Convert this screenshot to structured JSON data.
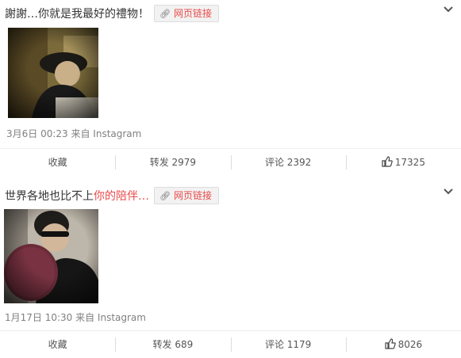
{
  "posts": [
    {
      "text_plain": "謝謝…你就是我最好的禮物！",
      "text_highlight": "",
      "weblink_label": "网页链接",
      "meta": "3月6日 00:23 来自 Instagram",
      "actions": {
        "fav": "收藏",
        "repost": "转发 2979",
        "comment": "评论 2392",
        "like": "17325"
      }
    },
    {
      "text_plain": "世界各地也比不上",
      "text_highlight": "你的陪伴…",
      "weblink_label": "网页链接",
      "meta": "1月17日 10:30 来自 Instagram",
      "actions": {
        "fav": "收藏",
        "repost": "转发 689",
        "comment": "评论 1179",
        "like": "8026"
      }
    }
  ],
  "colors": {
    "highlight": "#eb4a4a",
    "muted": "#808080"
  }
}
